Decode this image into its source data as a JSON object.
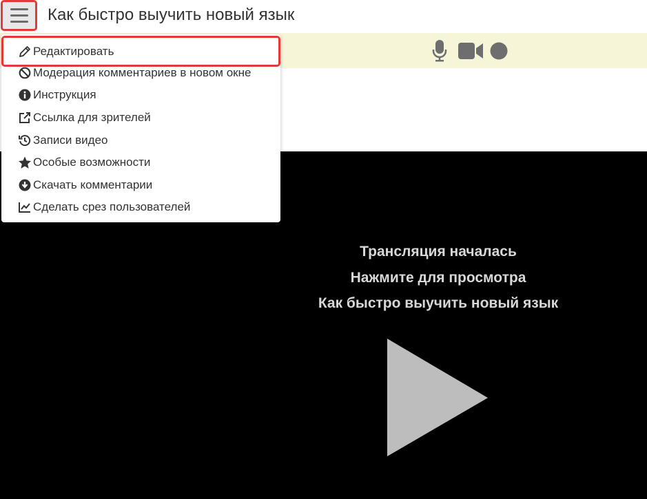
{
  "header": {
    "title": "Как быстро выучить новый язык",
    "menu_icon": "hamburger-icon"
  },
  "controls": {
    "icons": [
      "microphone-icon",
      "video-camera-icon",
      "record-icon"
    ],
    "bar_color": "#f6f5d8"
  },
  "menu": {
    "items": [
      {
        "label": "Редактировать",
        "icon": "pencil-icon"
      },
      {
        "label": "Модерация комментариев в новом окне",
        "icon": "ban-icon"
      },
      {
        "label": "Инструкция",
        "icon": "info-icon"
      },
      {
        "label": "Ссылка для зрителей",
        "icon": "external-link-icon"
      },
      {
        "label": "Записи видео",
        "icon": "history-icon"
      },
      {
        "label": "Особые возможности",
        "icon": "star-icon"
      },
      {
        "label": "Скачать комментарии",
        "icon": "download-icon"
      },
      {
        "label": "Сделать срез пользователей",
        "icon": "line-chart-icon"
      }
    ],
    "highlight_color": "#e53935"
  },
  "video": {
    "line1": "Трансляция началась",
    "line2": "Нажмите для просмотра",
    "line3": "Как быстро выучить новый язык",
    "play_icon": "play-icon"
  }
}
